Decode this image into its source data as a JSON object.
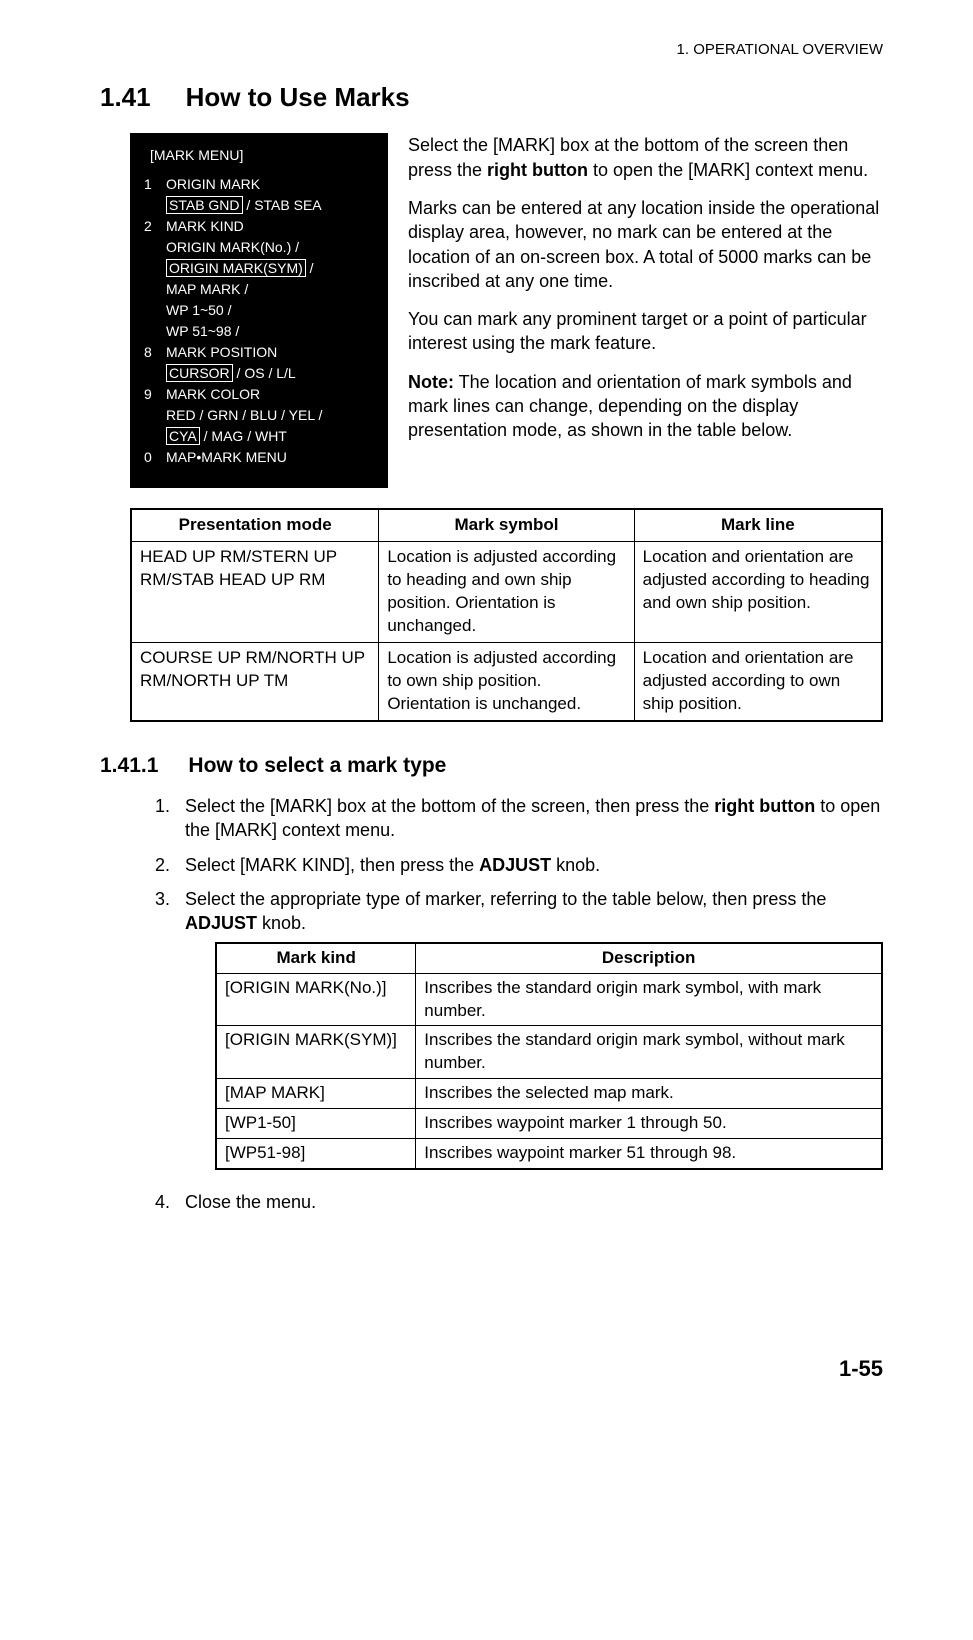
{
  "header": "1.  OPERATIONAL OVERVIEW",
  "section": {
    "num": "1.41",
    "title": "How to Use Marks"
  },
  "menu": {
    "title": "[MARK MENU]",
    "items": [
      {
        "num": "1",
        "label": "ORIGIN MARK",
        "sub_pre": "",
        "sub_boxed": "STAB GND",
        "sub_post": " / STAB SEA"
      },
      {
        "num": "2",
        "label": "MARK KIND",
        "lines": [
          "ORIGIN MARK(No.) /"
        ],
        "line2_boxed": "ORIGIN MARK(SYM)",
        "line2_post": " /",
        "lines_after": [
          "MAP MARK /",
          "WP 1~50 /",
          "WP 51~98 /"
        ]
      },
      {
        "num": "8",
        "label": "MARK POSITION",
        "sub_boxed": "CURSOR",
        "sub_post": " / OS / L/L"
      },
      {
        "num": "9",
        "label": "MARK COLOR",
        "lines": [
          "RED / GRN / BLU / YEL /"
        ],
        "line2_boxed": "CYA",
        "line2_post": " / MAG / WHT"
      },
      {
        "num": "0",
        "label": "MAP•MARK MENU"
      }
    ]
  },
  "paras": {
    "p1a": "Select the [MARK] box at the bottom of the screen then press the ",
    "p1b": "right button",
    "p1c": " to open the [MARK] context menu.",
    "p2": "Marks can be entered at any location inside the operational display area, however, no mark can be entered at the location of an on-screen box. A total of 5000 marks can be inscribed at any one time.",
    "p3": "You can mark any prominent target or a point of particular interest using the mark feature.",
    "p4a": "Note:",
    "p4b": " The location and orientation of mark symbols and mark lines can change, depending on the display presentation mode, as shown in the table below."
  },
  "table1": {
    "headers": [
      "Presentation mode",
      "Mark symbol",
      "Mark line"
    ],
    "rows": [
      [
        "HEAD UP RM/STERN UP RM/STAB HEAD UP RM",
        "Location is adjusted according to heading and own ship position. Orientation is unchanged.",
        "Location and orientation are adjusted according to heading and own ship position."
      ],
      [
        "COURSE UP RM/NORTH UP RM/NORTH UP TM",
        "Location is adjusted according to own ship position. Orientation is unchanged.",
        "Location and orientation are adjusted according to own ship position."
      ]
    ]
  },
  "subsection": {
    "num": "1.41.1",
    "title": "How to select a mark type"
  },
  "steps": {
    "s1a": "Select the [MARK] box at the bottom of the screen, then press the ",
    "s1b": "right button",
    "s1c": " to open the [MARK] context menu.",
    "s2a": "Select [MARK KIND], then press the ",
    "s2b": "ADJUST",
    "s2c": " knob.",
    "s3a": "Select the appropriate type of marker, referring to the table below, then press the ",
    "s3b": "ADJUST",
    "s3c": " knob.",
    "s4": "Close the menu."
  },
  "table2": {
    "headers": [
      "Mark kind",
      "Description"
    ],
    "rows": [
      [
        "[ORIGIN MARK(No.)]",
        "Inscribes the standard origin mark symbol, with mark number."
      ],
      [
        "[ORIGIN MARK(SYM)]",
        "Inscribes the standard origin mark symbol, without mark number."
      ],
      [
        "[MAP MARK]",
        "Inscribes the selected map mark."
      ],
      [
        "[WP1-50]",
        "Inscribes waypoint marker 1 through 50."
      ],
      [
        "[WP51-98]",
        "Inscribes waypoint marker 51 through 98."
      ]
    ]
  },
  "page_number": "1-55"
}
